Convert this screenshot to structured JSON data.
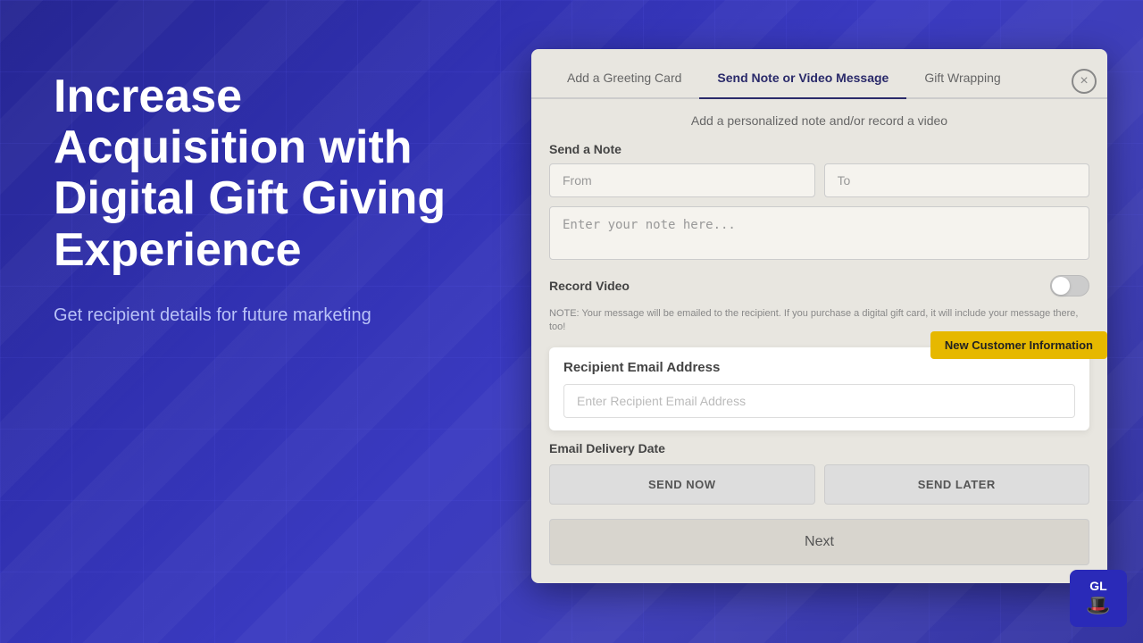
{
  "background": {
    "color": "#2020a0"
  },
  "left": {
    "main_heading": "Increase Acquisition with Digital Gift Giving Experience",
    "sub_heading": "Get recipient details for future marketing"
  },
  "modal": {
    "close_label": "×",
    "tabs": [
      {
        "id": "greeting",
        "label": "Add a Greeting Card",
        "active": false
      },
      {
        "id": "note",
        "label": "Send Note or Video Message",
        "active": true
      },
      {
        "id": "wrapping",
        "label": "Gift Wrapping",
        "active": false
      }
    ],
    "subtitle": "Add a personalized note and/or record a video",
    "send_note_label": "Send a Note",
    "from_placeholder": "From",
    "to_placeholder": "To",
    "note_placeholder": "Enter your note here...",
    "record_video_label": "Record Video",
    "note_text": "NOTE: Your message will be emailed to the recipient. If you purchase a digital gift card, it will include your message there, too!",
    "recipient_section": {
      "label": "Recipient Email Address",
      "placeholder": "Enter Recipient Email Address",
      "new_customer_badge": "New Customer Information"
    },
    "email_delivery_label": "Email Delivery Date",
    "send_now_label": "SEND NOW",
    "send_later_label": "SEND LATER",
    "next_label": "Next"
  },
  "logo": {
    "initials": "GL",
    "icon": "🎩"
  }
}
